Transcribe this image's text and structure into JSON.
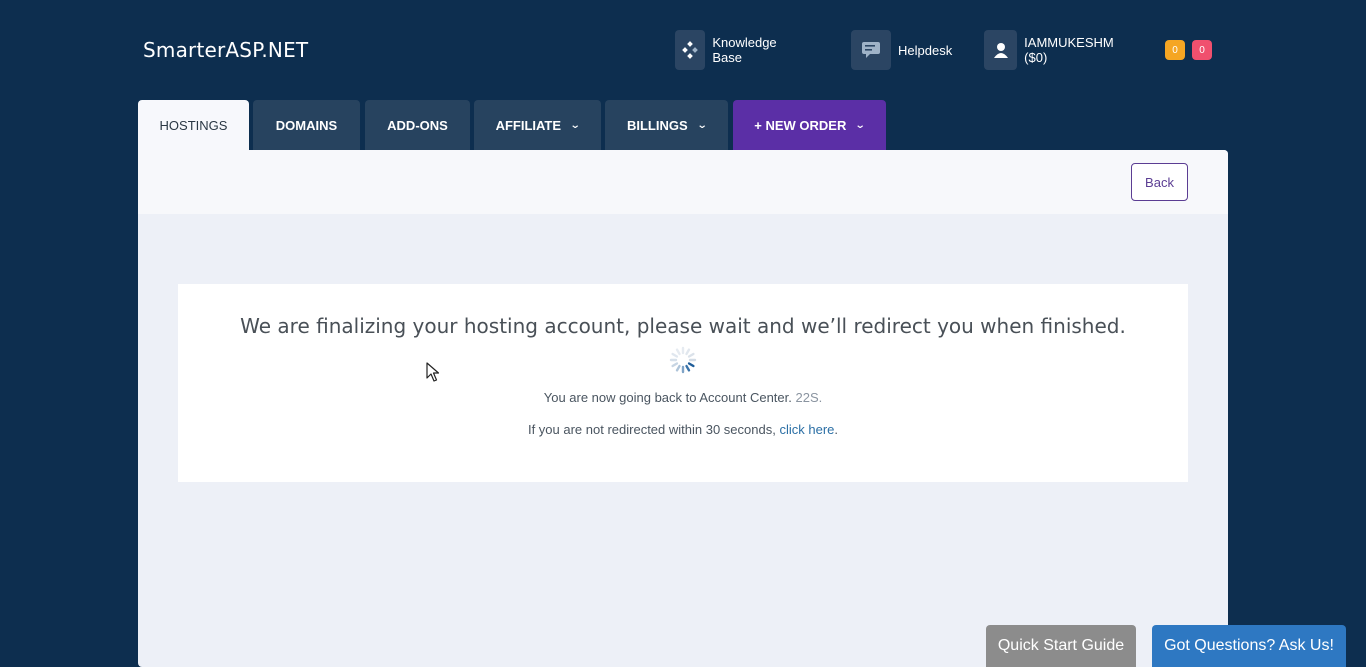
{
  "brand": {
    "name": "SmarterASP.NET"
  },
  "top_nav": {
    "knowledge_base": "Knowledge Base",
    "helpdesk": "Helpdesk",
    "account": "IAMMUKESHM ($0)",
    "badge_orange": "0",
    "badge_red": "0"
  },
  "tabs": {
    "hostings": "HOSTINGS",
    "domains": "DOMAINS",
    "addons": "ADD-ONS",
    "affiliate": "AFFILIATE",
    "billings": "BILLINGS",
    "new_order": "+ NEW ORDER"
  },
  "panel": {
    "back_label": "Back",
    "headline": "We are finalizing your hosting account, please wait and we’ll redirect you when finished.",
    "line1_text": "You are now going back to Account Center.",
    "countdown": "22S.",
    "line2_text": "If you are not redirected within 30 seconds,",
    "line2_link": "click here",
    "line2_end": "."
  },
  "floating": {
    "quick_start": "Quick Start Guide",
    "got_questions": "Got Questions? Ask Us!"
  },
  "colors": {
    "background": "#0d2e4f",
    "tab": "#27435f",
    "new_order": "#5b2fa6",
    "badge_orange": "#f5a623",
    "badge_red": "#f0506e",
    "quick_start_btn": "#8c8c8c",
    "questions_btn": "#2e78c2"
  }
}
